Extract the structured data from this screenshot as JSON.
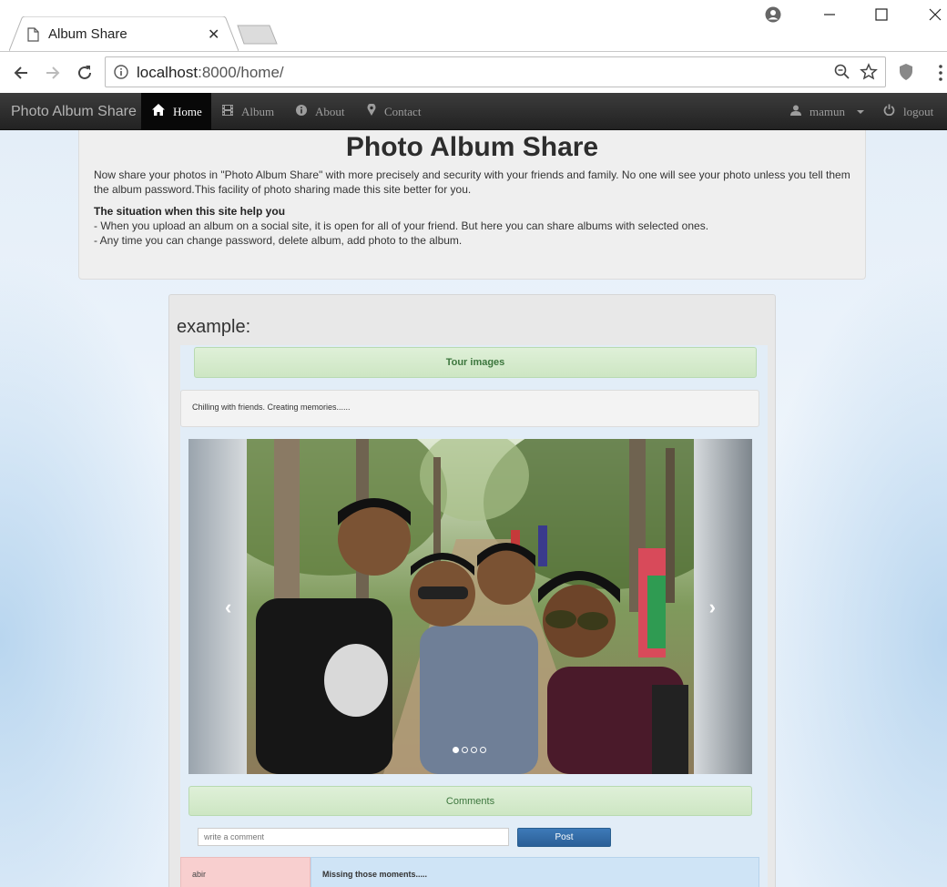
{
  "browser": {
    "tab_title": "Album Share",
    "url_host": "localhost",
    "url_rest": ":8000/home/"
  },
  "navbar": {
    "brand": "Photo Album Share",
    "items": [
      {
        "label": "Home",
        "icon": "home-icon"
      },
      {
        "label": "Album",
        "icon": "film-icon"
      },
      {
        "label": "About",
        "icon": "info-sign-icon"
      },
      {
        "label": "Contact",
        "icon": "map-marker-icon"
      }
    ],
    "user": "mamun",
    "logout": "logout"
  },
  "hero": {
    "title": "Photo Album Share",
    "intro": "Now share your photos in \"Photo Album Share\" with more precisely and security with your friends and family. No one will see your photo unless you tell them the album password.This facility of photo sharing made this site better for you.",
    "situation_heading": "The situation when this site help you",
    "points": [
      "- When you upload an album on a social site, it is open for all of your friend. But here you can share albums with selected ones.",
      "- Any time you can change password, delete album, add photo to the album."
    ]
  },
  "example": {
    "title": "example:",
    "album_title": "Tour images",
    "album_description": "Chilling with friends. Creating memories......",
    "carousel": {
      "slides": 4,
      "active": 0
    },
    "comments_heading": "Comments",
    "comment_placeholder": "write a comment",
    "post_label": "Post",
    "comments": [
      {
        "user": "abir",
        "text": "Missing those moments....."
      }
    ]
  },
  "colors": {
    "navbar_bg": "#222222",
    "success_panel": "#dff0d8",
    "post_button": "#2b5f97"
  }
}
